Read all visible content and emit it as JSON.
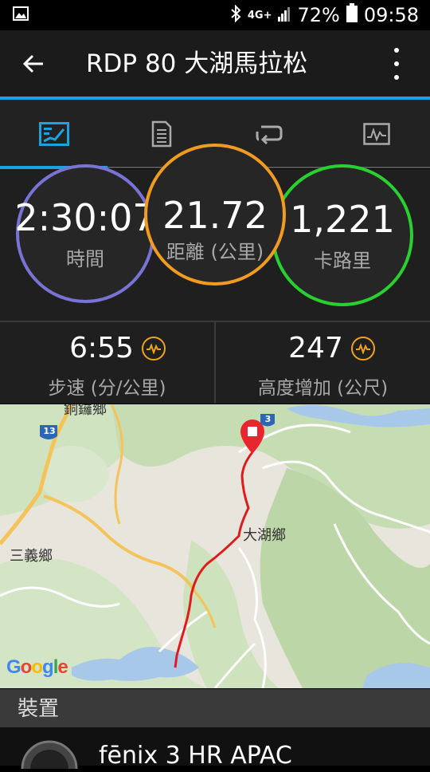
{
  "status_bar": {
    "network": "4G+",
    "battery": "72%",
    "time": "09:58"
  },
  "app_bar": {
    "title": "RDP 80 大湖馬拉松"
  },
  "tabs": [
    {
      "name": "overview",
      "icon": "overview-chart-icon",
      "selected": true
    },
    {
      "name": "details",
      "icon": "document-icon",
      "selected": false
    },
    {
      "name": "laps",
      "icon": "repeat-icon",
      "selected": false
    },
    {
      "name": "graphs",
      "icon": "graph-icon",
      "selected": false
    }
  ],
  "stats": {
    "time": {
      "value": "2:30:07",
      "label": "時間",
      "color": "#7a73d6"
    },
    "distance": {
      "value": "21.72",
      "label": "距離 (公里)",
      "color": "#f19b21"
    },
    "calories": {
      "value": "1,221",
      "label": "卡路里",
      "color": "#28d12f"
    },
    "pace": {
      "value": "6:55",
      "label": "步速 (分/公里)"
    },
    "elevation_gain": {
      "value": "247",
      "label": "高度增加 (公尺)"
    }
  },
  "map": {
    "labels": {
      "town_top": "銅鑼鄉",
      "town_left": "三義鄉",
      "town_center": "大湖鄉",
      "road_13": "13",
      "road_3": "3"
    },
    "google": [
      "G",
      "o",
      "o",
      "g",
      "l",
      "e"
    ],
    "route_color": "#e01b1b"
  },
  "devices": {
    "header": "裝置",
    "device_name": "fēnix 3 HR APAC"
  }
}
